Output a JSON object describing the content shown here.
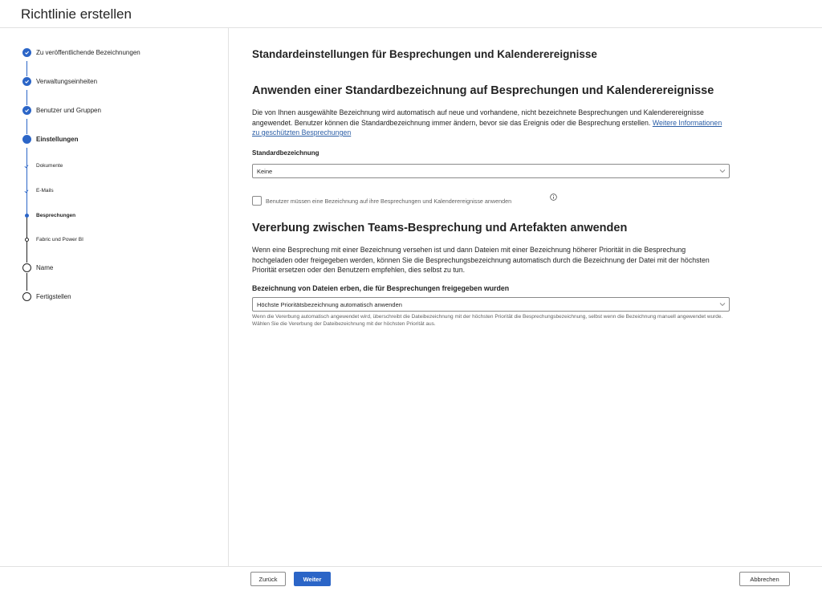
{
  "header": {
    "title": "Richtlinie erstellen"
  },
  "steps": [
    {
      "label": "Zu veröffentlichende Bezeichnungen",
      "state": "done"
    },
    {
      "label": "Verwaltungseinheiten",
      "state": "done"
    },
    {
      "label": "Benutzer und Gruppen",
      "state": "done"
    },
    {
      "label": "Einstellungen",
      "state": "current"
    },
    {
      "label": "Dokumente",
      "state": "sub-done"
    },
    {
      "label": "E-Mails",
      "state": "sub-done"
    },
    {
      "label": "Besprechungen",
      "state": "sub-current"
    },
    {
      "label": "Fabric und Power BI",
      "state": "sub-pending"
    },
    {
      "label": "Name",
      "state": "pending"
    },
    {
      "label": "Fertigstellen",
      "state": "pending"
    }
  ],
  "main": {
    "page_title": "Standardeinstellungen für Besprechungen und Kalenderereignisse",
    "section1": {
      "title": "Anwenden einer Standardbezeichnung auf Besprechungen und Kalenderereignisse",
      "description": "Die von Ihnen ausgewählte Bezeichnung wird automatisch auf neue und vorhandene, nicht bezeichnete Besprechungen und Kalenderereignisse angewendet. Benutzer können die Standardbezeichnung immer ändern, bevor sie das Ereignis oder die Besprechung erstellen.",
      "link": "Weitere Informationen zu geschützten Besprechungen",
      "field_label": "Standardbezeichnung",
      "select_value": "Keine",
      "checkbox_label": "Benutzer müssen eine Bezeichnung auf ihre Besprechungen und Kalenderereignisse anwenden"
    },
    "section2": {
      "title": "Vererbung zwischen Teams-Besprechung und Artefakten anwenden",
      "description": "Wenn eine Besprechung mit einer Bezeichnung versehen ist und dann Dateien mit einer Bezeichnung höherer Priorität in die Besprechung hochgeladen oder freigegeben werden, können Sie die Besprechungsbezeichnung automatisch durch die Bezeichnung der Datei mit der höchsten Priorität ersetzen oder den Benutzern empfehlen, dies selbst zu tun.",
      "field_label": "Bezeichnung von Dateien erben, die für Besprechungen freigegeben wurden",
      "select_value": "Höchste Prioritätsbezeichnung automatisch anwenden",
      "help_text": "Wenn die Vererbung automatisch angewendet wird, überschreibt die Dateibezeichnung mit der höchsten Priorität die Besprechungsbezeichnung, selbst wenn die Bezeichnung manuell angewendet wurde. Wählen Sie die Vererbung der Dateibezeichnung mit der höchsten Priorität aus."
    }
  },
  "footer": {
    "back_label": "Zurück",
    "next_label": "Weiter",
    "cancel_label": "Abbrechen"
  },
  "colors": {
    "accent": "#2b65c7",
    "link": "#2b5ea6",
    "border": "#e1e1e1"
  }
}
